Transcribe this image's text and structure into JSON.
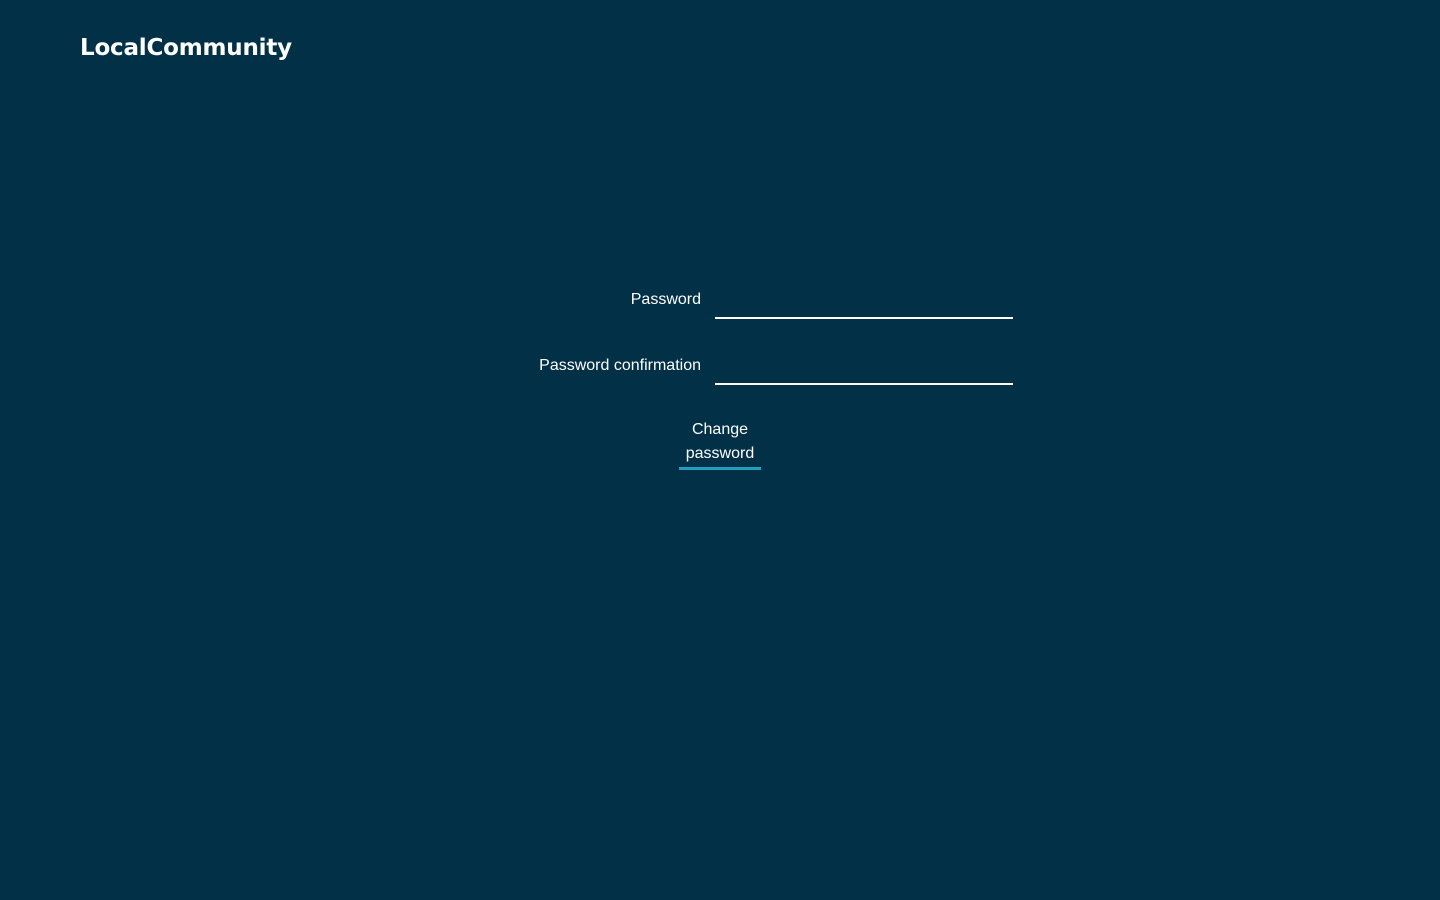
{
  "header": {
    "brand": "LocalCommunity"
  },
  "form": {
    "password_label": "Password",
    "password_value": "",
    "confirmation_label": "Password confirmation",
    "confirmation_value": "",
    "submit_label": "Change password"
  },
  "colors": {
    "background": "#023047",
    "text": "#ffffff",
    "accent": "#219ebc"
  }
}
